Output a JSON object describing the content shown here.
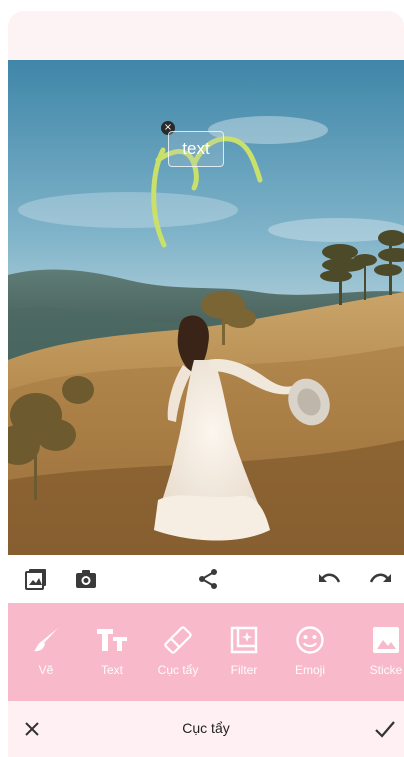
{
  "canvas": {
    "overlay_text": "text",
    "close_symbol": "×"
  },
  "action_bar": {
    "icons": [
      "gallery-icon",
      "camera-icon",
      "share-icon",
      "undo-icon",
      "redo-icon"
    ]
  },
  "tools": [
    {
      "label": "Vẽ",
      "icon": "brush-icon"
    },
    {
      "label": "Text",
      "icon": "text-icon"
    },
    {
      "label": "Cục tẩy",
      "icon": "eraser-icon"
    },
    {
      "label": "Filter",
      "icon": "filter-icon"
    },
    {
      "label": "Emoji",
      "icon": "emoji-icon"
    },
    {
      "label": "Sticke",
      "icon": "sticker-icon"
    }
  ],
  "footer": {
    "title": "Cục tẩy",
    "cancel_icon": "close-icon",
    "confirm_icon": "check-icon"
  },
  "colors": {
    "toolbar_pink": "#f8bacb",
    "footer_bg": "#fff0f3",
    "scribble": "#c9e06a"
  }
}
